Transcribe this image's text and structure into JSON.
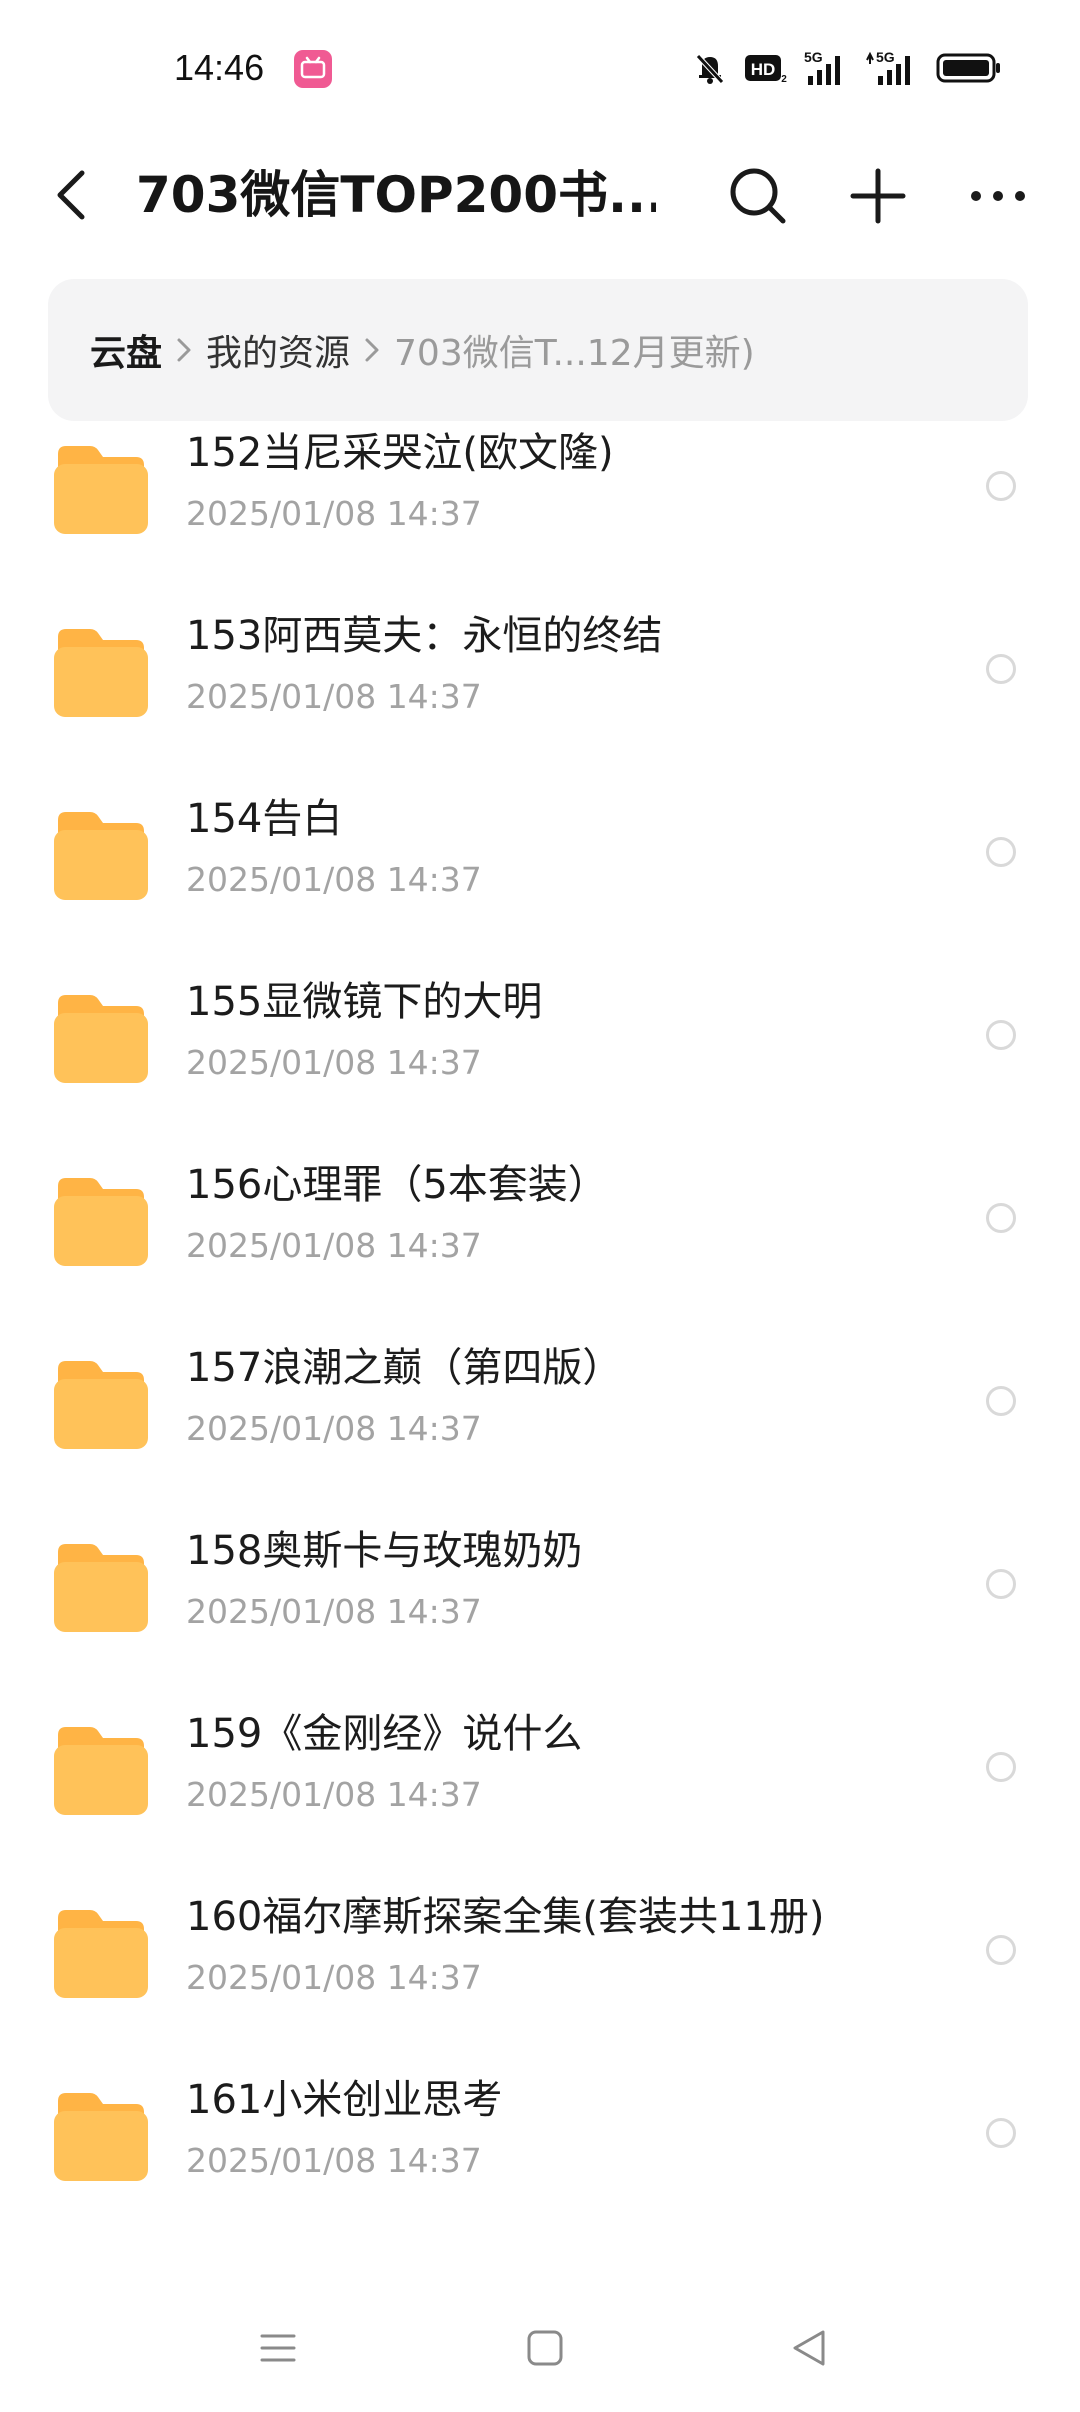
{
  "status_bar": {
    "time": "14:46",
    "icons": [
      "app-notification-icon",
      "mute-bell-icon",
      "hd-icon",
      "signal-5g-icon",
      "signal-5g-icon",
      "battery-icon"
    ],
    "hd_label": "HD",
    "network_1": "5G",
    "network_2": "5G"
  },
  "header": {
    "title": "703微信TOP200书...",
    "icons": [
      "back-icon",
      "search-icon",
      "plus-icon",
      "more-icon"
    ]
  },
  "breadcrumb": {
    "root": "云盘",
    "mid": "我的资源",
    "current": "703微信T...12月更新)"
  },
  "colors": {
    "folder": "#ffc259",
    "folder_tab": "#ffb445",
    "breadcrumb_bg": "#f4f4f5",
    "secondary_text": "#a3a3a3"
  },
  "files": [
    {
      "name": "152当尼采哭泣(欧文隆)",
      "date": "2025/01/08 14:37"
    },
    {
      "name": "153阿西莫夫：永恒的终结",
      "date": "2025/01/08 14:37"
    },
    {
      "name": "154告白",
      "date": "2025/01/08 14:37"
    },
    {
      "name": "155显微镜下的大明",
      "date": "2025/01/08 14:37"
    },
    {
      "name": "156心理罪（5本套装）",
      "date": "2025/01/08 14:37"
    },
    {
      "name": "157浪潮之巅（第四版）",
      "date": "2025/01/08 14:37"
    },
    {
      "name": "158奥斯卡与玫瑰奶奶",
      "date": "2025/01/08 14:37"
    },
    {
      "name": "159《金刚经》说什么",
      "date": "2025/01/08 14:37"
    },
    {
      "name": "160福尔摩斯探案全集(套装共11册)",
      "date": "2025/01/08 14:37"
    },
    {
      "name": "161小米创业思考",
      "date": "2025/01/08 14:37"
    }
  ],
  "nav_bar": {
    "icons": [
      "menu-icon",
      "home-icon",
      "back-triangle-icon"
    ]
  }
}
